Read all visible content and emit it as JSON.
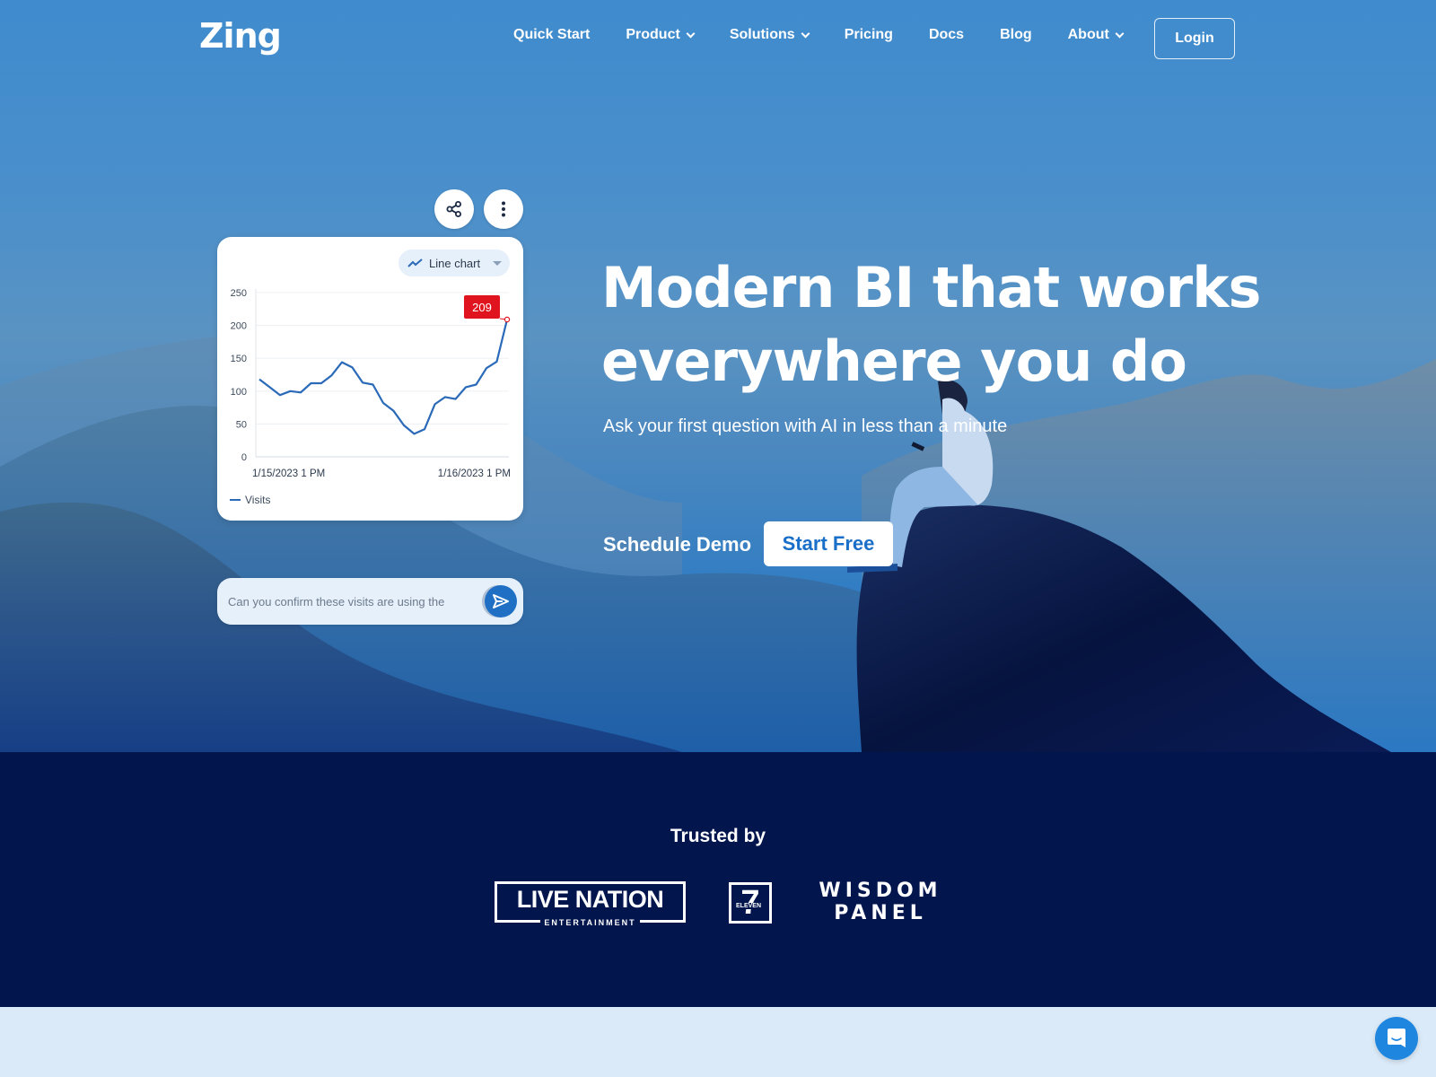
{
  "brand": {
    "name": "Zing"
  },
  "nav": {
    "items": [
      {
        "label": "Quick Start",
        "dropdown": false
      },
      {
        "label": "Product",
        "dropdown": true
      },
      {
        "label": "Solutions",
        "dropdown": true
      },
      {
        "label": "Pricing",
        "dropdown": false
      },
      {
        "label": "Docs",
        "dropdown": false
      },
      {
        "label": "Blog",
        "dropdown": false
      },
      {
        "label": "About",
        "dropdown": true
      }
    ],
    "login_label": "Login"
  },
  "hero": {
    "headline_line1": "Modern BI that works",
    "headline_line2": "everywhere you do",
    "subhead": "Ask your first question with AI in less than a minute",
    "schedule_demo_label": "Schedule Demo",
    "start_free_label": "Start Free"
  },
  "chart_card": {
    "share_icon": "share-icon",
    "more_icon": "more-vertical-icon",
    "chart_type_label": "Line chart",
    "ask_input_value": "Can you confirm these visits are using the",
    "send_icon": "send-icon"
  },
  "chart_data": {
    "type": "line",
    "title": "",
    "xlabel": "",
    "ylabel": "",
    "ylim": [
      0,
      250
    ],
    "yticks": [
      0,
      50,
      100,
      150,
      200,
      250
    ],
    "xtick_labels": [
      "1/15/2023 1 PM",
      "1/16/2023 1 PM"
    ],
    "grid": true,
    "legend": "bottom-left",
    "series": [
      {
        "name": "Visits",
        "color": "#2a6ab8",
        "values": [
          118,
          106,
          94,
          100,
          98,
          112,
          112,
          124,
          144,
          136,
          113,
          110,
          82,
          70,
          48,
          35,
          42,
          80,
          91,
          88,
          106,
          110,
          135,
          145,
          209
        ]
      }
    ],
    "annotation": {
      "label": "209",
      "point_index": 24,
      "color": "#e0141e"
    }
  },
  "trusted": {
    "title": "Trusted by",
    "logos": [
      {
        "name": "Live Nation Entertainment",
        "text": "LIVE NATION",
        "subtext": "ENTERTAINMENT"
      },
      {
        "name": "7-Eleven",
        "text": "7",
        "subtext": "ELEVEN"
      },
      {
        "name": "Wisdom Panel",
        "text": "WISDOM",
        "subtext": "PANEL"
      }
    ]
  },
  "chat_widget": {
    "icon": "chat-bubble-icon"
  },
  "colors": {
    "brand_blue": "#1a6fc9",
    "navy": "#02164d",
    "highlight_red": "#e0141e",
    "line_blue": "#2a6ab8"
  }
}
